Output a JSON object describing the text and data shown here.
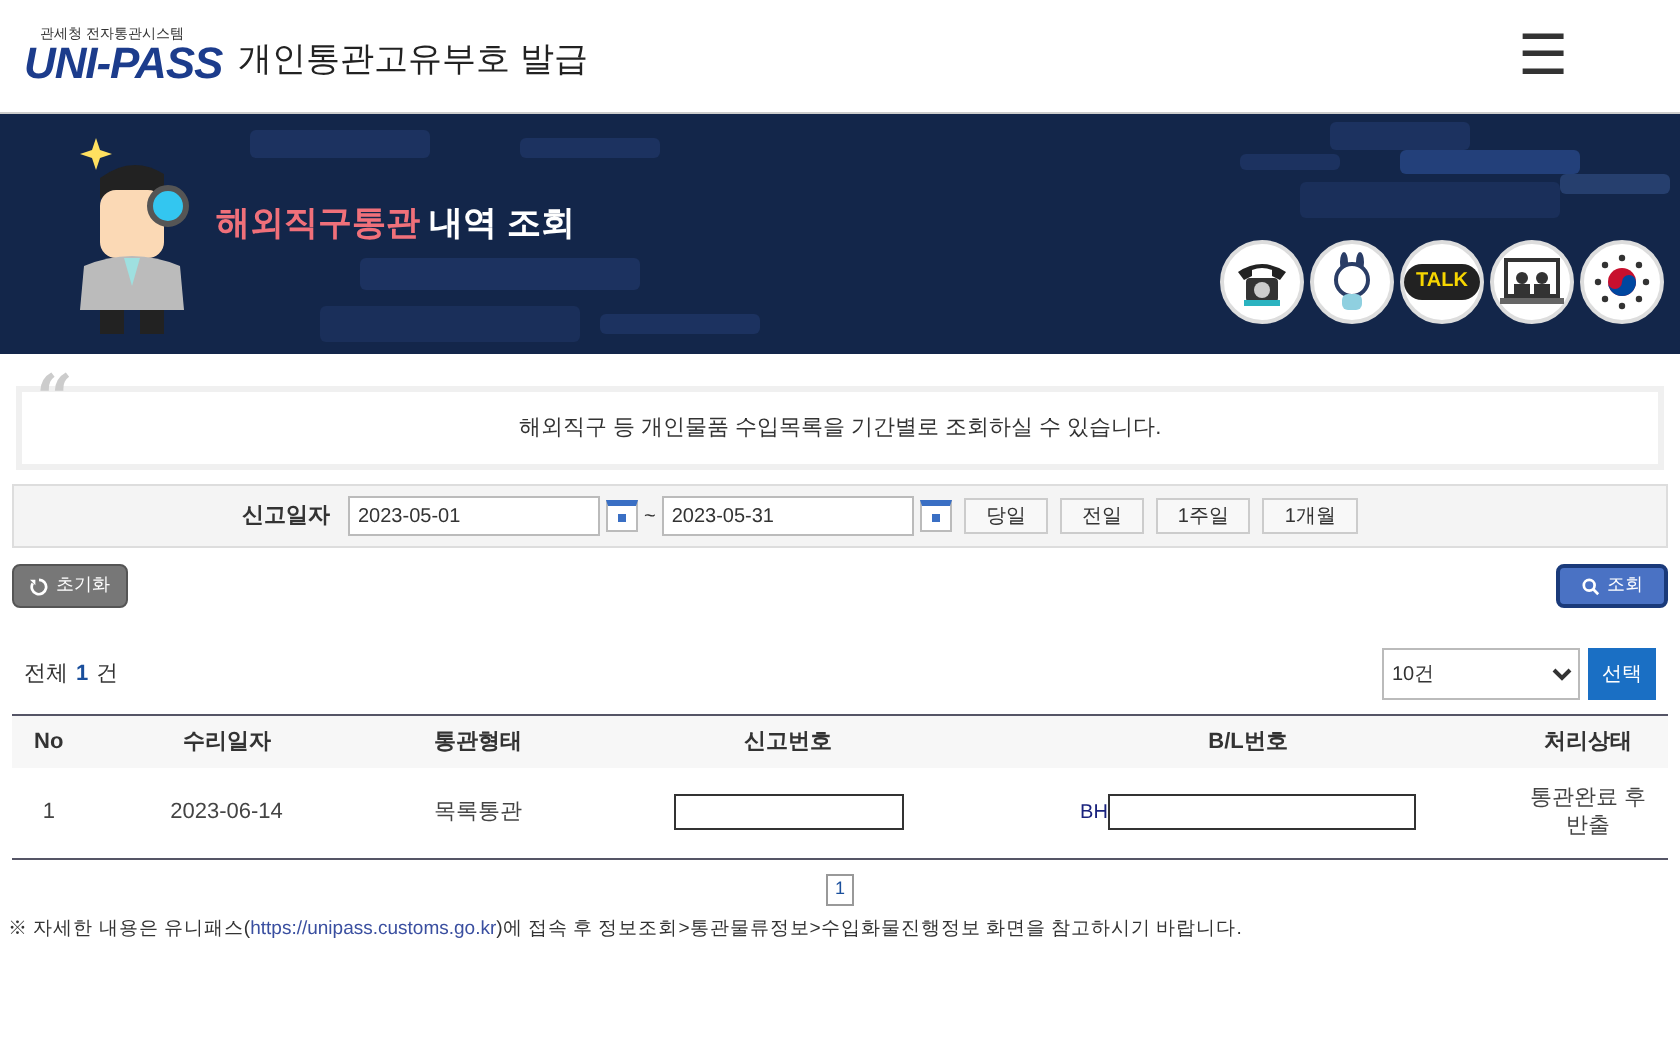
{
  "header": {
    "logo_caption": "관세청 전자통관시스템",
    "logo": "UNI-PASS",
    "title": "개인통관고유부호 발급",
    "menu_icon": "☰"
  },
  "banner": {
    "title_highlight": "해외직구통관",
    "title_rest": "내역 조회",
    "quick_icons": [
      {
        "kind": "phone"
      },
      {
        "kind": "mascot"
      },
      {
        "kind": "talk",
        "label": "TALK"
      },
      {
        "kind": "video"
      },
      {
        "kind": "emblem"
      }
    ]
  },
  "notice_quote": "“",
  "notice": "해외직구 등 개인물품 수입목록을 기간별로 조회하실 수 있습니다.",
  "search": {
    "label": "신고일자",
    "from": "2023-05-01",
    "separator": "~",
    "to": "2023-05-31",
    "periods": [
      {
        "label": "당일"
      },
      {
        "label": "전일"
      },
      {
        "label": "1주일"
      },
      {
        "label": "1개월"
      }
    ]
  },
  "reset_button": "초기화",
  "search_button": "조회",
  "results": {
    "total_label": "전체",
    "total": "1",
    "unit": "건",
    "page_size": "10건",
    "select_button": "선택"
  },
  "table": {
    "columns": [
      "No",
      "수리일자",
      "통관형태",
      "신고번호",
      "B/L번호",
      "처리상태"
    ],
    "rows": [
      {
        "no": "1",
        "date": "2023-06-14",
        "type": "목록통관",
        "bl_prefix": "BH",
        "status": "통관완료 후 반출"
      }
    ]
  },
  "pagination": [
    {
      "label": "1",
      "selected": true
    }
  ],
  "footnote": {
    "before": "※ 자세한 내용은 유니패스(",
    "link": "https://unipass.customs.go.kr",
    "after": ")에 접속 후 정보조회>통관물류정보>수입화물진행정보 화면을 참고하시기 바랍니다."
  }
}
